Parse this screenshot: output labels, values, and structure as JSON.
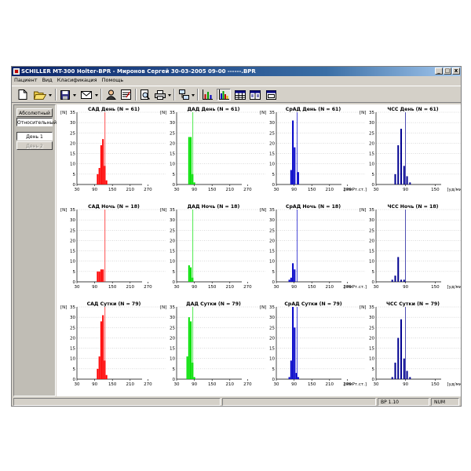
{
  "window": {
    "title": "SCHILLER MT-300 Holter-BPR - Миронов Сергей 30-03-2005 09-00 ------.BPR",
    "controls": [
      "_",
      "□",
      "x"
    ]
  },
  "menu": [
    "Пациент",
    "Вид",
    "Класификация",
    "Помощь"
  ],
  "toolbar": {
    "buttons": [
      "new-file-icon",
      "open-folder-icon",
      "save-icon",
      "mail-icon",
      "patient-icon",
      "report-icon",
      "print-preview-icon",
      "print-icon",
      "network-icon",
      "bar-chart-icon",
      "histogram-icon",
      "table-icon",
      "table-values-icon",
      "window-icon"
    ],
    "pressed": "histogram-icon"
  },
  "left_panel": {
    "buttons": [
      {
        "label": "Абсолютный",
        "state": "normal"
      },
      {
        "label": "Относительный",
        "state": "selected"
      },
      {
        "label": "День 1",
        "state": "selected"
      },
      {
        "label": "День 2",
        "state": "disabled"
      }
    ]
  },
  "status_bar": {
    "version": "BP 1.10",
    "mode": "NUM"
  },
  "colors": {
    "sad": "#ff0000",
    "dad": "#00e000",
    "srad": "#0000c8",
    "chss": "#000090",
    "marker": "#ff0000"
  },
  "chart_data": [
    {
      "type": "bar",
      "title": "САД День (N = 61)",
      "ylabel": "[N]",
      "xlabel": "",
      "color": "#ff0000",
      "marker_color": "#ff0000",
      "marker": 125,
      "ylim": [
        0,
        35
      ],
      "yticks": [
        0,
        5,
        10,
        15,
        20,
        25,
        30,
        35
      ],
      "xlim": [
        30,
        330
      ],
      "xticks": [
        30,
        90,
        150,
        210,
        270
      ],
      "bars": [
        {
          "x": 100,
          "y": 5
        },
        {
          "x": 106,
          "y": 8
        },
        {
          "x": 112,
          "y": 19
        },
        {
          "x": 118,
          "y": 22
        },
        {
          "x": 124,
          "y": 9
        },
        {
          "x": 130,
          "y": 2
        }
      ]
    },
    {
      "type": "bar",
      "title": "ДАД День (N = 61)",
      "ylabel": "[N]",
      "xlabel": "",
      "color": "#00e000",
      "marker_color": "#00e000",
      "marker": 85,
      "ylim": [
        0,
        35
      ],
      "yticks": [
        0,
        5,
        10,
        15,
        20,
        25,
        30,
        35
      ],
      "xlim": [
        30,
        330
      ],
      "xticks": [
        30,
        90,
        150,
        210,
        270
      ],
      "bars": [
        {
          "x": 72,
          "y": 23
        },
        {
          "x": 78,
          "y": 23
        },
        {
          "x": 84,
          "y": 5
        },
        {
          "x": 90,
          "y": 1
        }
      ]
    },
    {
      "type": "bar",
      "title": "СрАД День (N = 61)",
      "ylabel": "[N]",
      "xlabel": "[ммРт.ст.]",
      "color": "#0000c8",
      "marker_color": "#0000c8",
      "marker": 100,
      "ylim": [
        0,
        35
      ],
      "yticks": [
        0,
        5,
        10,
        15,
        20,
        25,
        30,
        35
      ],
      "xlim": [
        30,
        330
      ],
      "xticks": [
        30,
        90,
        150,
        210,
        270
      ],
      "bars": [
        {
          "x": 80,
          "y": 7
        },
        {
          "x": 86,
          "y": 31
        },
        {
          "x": 92,
          "y": 18
        },
        {
          "x": 104,
          "y": 6
        }
      ]
    },
    {
      "type": "bar",
      "title": "ЧСС День (N = 61)",
      "ylabel": "[N]",
      "xlabel": "[уд/мин]",
      "color": "#000090",
      "marker_color": "#000090",
      "marker": 90,
      "ylim": [
        0,
        35
      ],
      "yticks": [
        0,
        5,
        10,
        15,
        20,
        25,
        30,
        35
      ],
      "xlim": [
        30,
        210
      ],
      "xticks": [
        30,
        90,
        150
      ],
      "bars": [
        {
          "x": 69,
          "y": 5
        },
        {
          "x": 75,
          "y": 19
        },
        {
          "x": 81,
          "y": 27
        },
        {
          "x": 87,
          "y": 9
        },
        {
          "x": 93,
          "y": 4
        },
        {
          "x": 99,
          "y": 1
        }
      ]
    },
    {
      "type": "bar",
      "title": "САД Ночь (N = 18)",
      "ylabel": "[N]",
      "xlabel": "",
      "color": "#ff0000",
      "marker_color": "#ff0000",
      "marker": 125,
      "ylim": [
        0,
        35
      ],
      "yticks": [
        0,
        5,
        10,
        15,
        20,
        25,
        30,
        35
      ],
      "xlim": [
        30,
        330
      ],
      "xticks": [
        30,
        90,
        150,
        210,
        270
      ],
      "bars": [
        {
          "x": 100,
          "y": 5
        },
        {
          "x": 106,
          "y": 5
        },
        {
          "x": 112,
          "y": 6
        },
        {
          "x": 118,
          "y": 6
        }
      ]
    },
    {
      "type": "bar",
      "title": "ДАД Ночь (N = 18)",
      "ylabel": "[N]",
      "xlabel": "",
      "color": "#00e000",
      "marker_color": "#00e000",
      "marker": 85,
      "ylim": [
        0,
        35
      ],
      "yticks": [
        0,
        5,
        10,
        15,
        20,
        25,
        30,
        35
      ],
      "xlim": [
        30,
        330
      ],
      "xticks": [
        30,
        90,
        150,
        210,
        270
      ],
      "bars": [
        {
          "x": 72,
          "y": 8
        },
        {
          "x": 78,
          "y": 7
        },
        {
          "x": 84,
          "y": 2
        }
      ]
    },
    {
      "type": "bar",
      "title": "СрАД Ночь (N = 18)",
      "ylabel": "[N]",
      "xlabel": "[ммРт.ст.]",
      "color": "#0000c8",
      "marker_color": "#0000c8",
      "marker": 100,
      "ylim": [
        0,
        35
      ],
      "yticks": [
        0,
        5,
        10,
        15,
        20,
        25,
        30,
        35
      ],
      "xlim": [
        30,
        330
      ],
      "xticks": [
        30,
        90,
        150,
        210,
        270
      ],
      "bars": [
        {
          "x": 74,
          "y": 1
        },
        {
          "x": 80,
          "y": 2
        },
        {
          "x": 86,
          "y": 9
        },
        {
          "x": 92,
          "y": 6
        }
      ]
    },
    {
      "type": "bar",
      "title": "ЧСС Ночь (N = 18)",
      "ylabel": "[N]",
      "xlabel": "[уд/мин]",
      "color": "#000090",
      "marker_color": "#000090",
      "marker": 90,
      "ylim": [
        0,
        35
      ],
      "yticks": [
        0,
        5,
        10,
        15,
        20,
        25,
        30,
        35
      ],
      "xlim": [
        30,
        210
      ],
      "xticks": [
        30,
        90,
        150
      ],
      "bars": [
        {
          "x": 63,
          "y": 1
        },
        {
          "x": 69,
          "y": 3
        },
        {
          "x": 75,
          "y": 12
        },
        {
          "x": 81,
          "y": 1
        },
        {
          "x": 87,
          "y": 1
        }
      ]
    },
    {
      "type": "bar",
      "title": "САД Сутки (N = 79)",
      "ylabel": "[N]",
      "xlabel": "",
      "color": "#ff0000",
      "marker_color": "#ff0000",
      "marker": 125,
      "ylim": [
        0,
        35
      ],
      "yticks": [
        0,
        5,
        10,
        15,
        20,
        25,
        30,
        35
      ],
      "xlim": [
        30,
        330
      ],
      "xticks": [
        30,
        90,
        150,
        210,
        270
      ],
      "bars": [
        {
          "x": 100,
          "y": 5
        },
        {
          "x": 106,
          "y": 11
        },
        {
          "x": 112,
          "y": 28
        },
        {
          "x": 118,
          "y": 31
        },
        {
          "x": 124,
          "y": 9
        },
        {
          "x": 130,
          "y": 2
        }
      ]
    },
    {
      "type": "bar",
      "title": "ДАД Сутки (N = 79)",
      "ylabel": "[N]",
      "xlabel": "",
      "color": "#00e000",
      "marker_color": "#00e000",
      "marker": 85,
      "ylim": [
        0,
        35
      ],
      "yticks": [
        0,
        5,
        10,
        15,
        20,
        25,
        30,
        35
      ],
      "xlim": [
        30,
        330
      ],
      "xticks": [
        30,
        90,
        150,
        210,
        270
      ],
      "bars": [
        {
          "x": 66,
          "y": 11
        },
        {
          "x": 72,
          "y": 30
        },
        {
          "x": 78,
          "y": 28
        },
        {
          "x": 84,
          "y": 8
        },
        {
          "x": 90,
          "y": 1
        }
      ]
    },
    {
      "type": "bar",
      "title": "СрАД Сутки (N = 79)",
      "ylabel": "[N]",
      "xlabel": "[ммРт.ст.]",
      "color": "#0000c8",
      "marker_color": "#0000c8",
      "marker": 100,
      "ylim": [
        0,
        35
      ],
      "yticks": [
        0,
        5,
        10,
        15,
        20,
        25,
        30,
        35
      ],
      "xlim": [
        30,
        330
      ],
      "xticks": [
        30,
        90,
        150,
        210,
        270
      ],
      "bars": [
        {
          "x": 74,
          "y": 1
        },
        {
          "x": 80,
          "y": 9
        },
        {
          "x": 86,
          "y": 40
        },
        {
          "x": 92,
          "y": 25
        },
        {
          "x": 98,
          "y": 3
        },
        {
          "x": 104,
          "y": 1
        }
      ]
    },
    {
      "type": "bar",
      "title": "ЧСС Сутки (N = 79)",
      "ylabel": "[N]",
      "xlabel": "[уд/мин]",
      "color": "#000090",
      "marker_color": "#000090",
      "marker": 90,
      "ylim": [
        0,
        35
      ],
      "yticks": [
        0,
        5,
        10,
        15,
        20,
        25,
        30,
        35
      ],
      "xlim": [
        30,
        210
      ],
      "xticks": [
        30,
        90,
        150
      ],
      "bars": [
        {
          "x": 63,
          "y": 1
        },
        {
          "x": 69,
          "y": 8
        },
        {
          "x": 75,
          "y": 20
        },
        {
          "x": 81,
          "y": 29
        },
        {
          "x": 87,
          "y": 10
        },
        {
          "x": 93,
          "y": 4
        },
        {
          "x": 99,
          "y": 1
        }
      ]
    }
  ]
}
